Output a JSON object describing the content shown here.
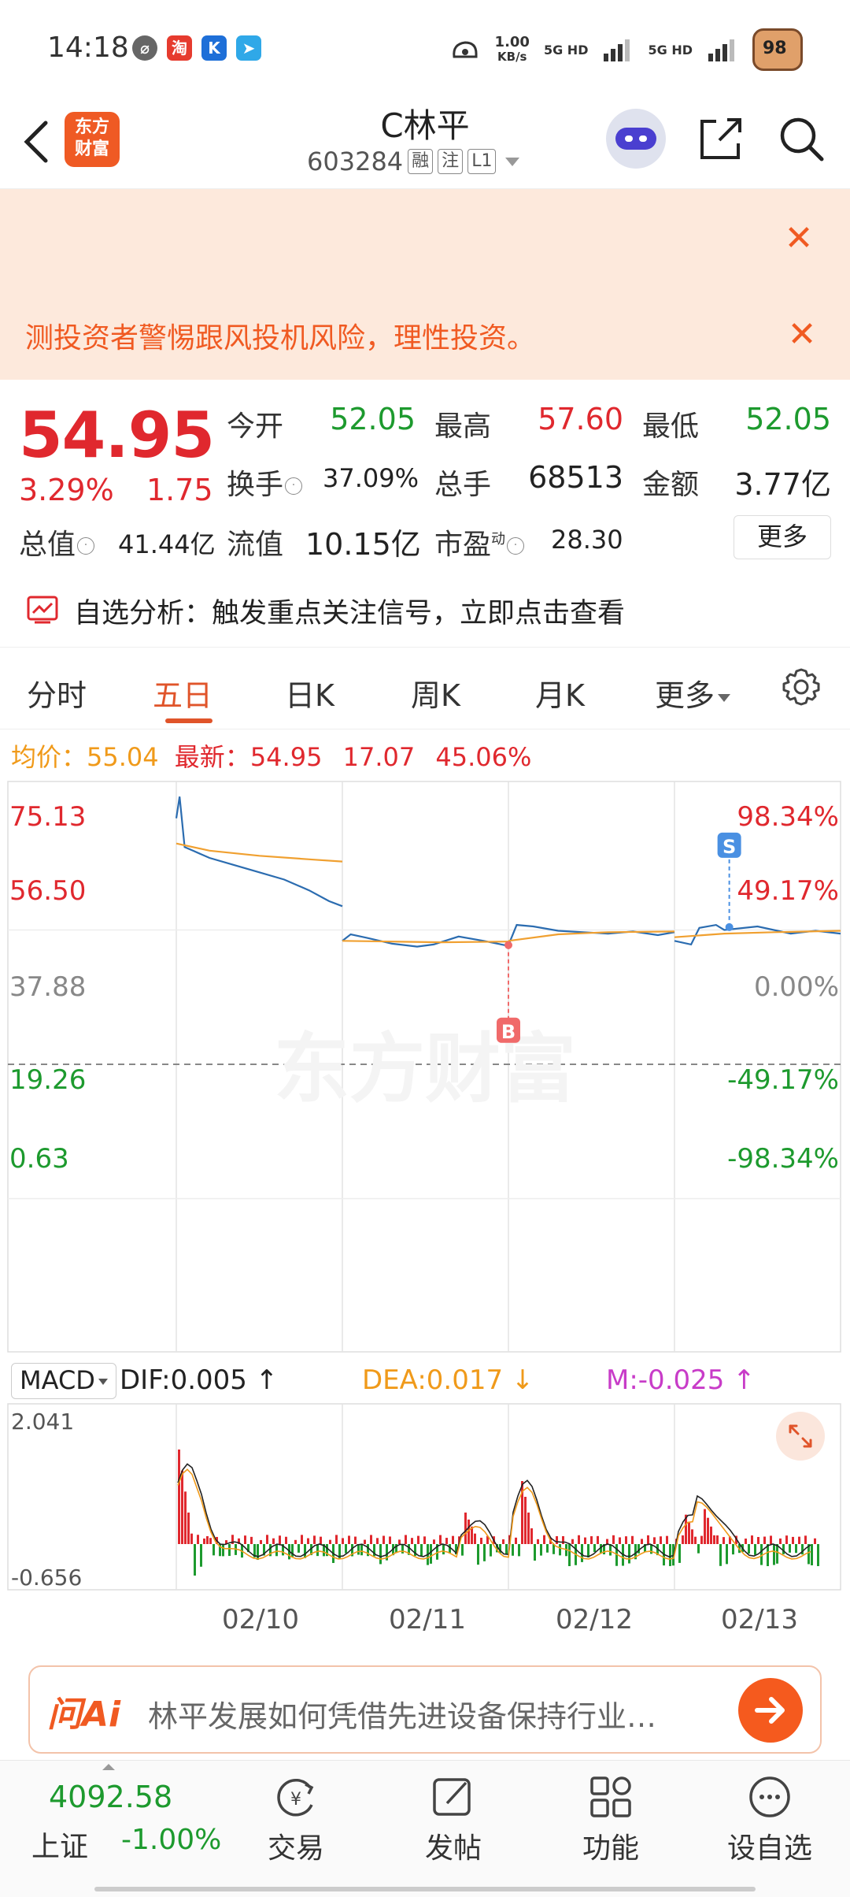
{
  "status_bar": {
    "time": "14:18",
    "net_speed_value": "1.00",
    "net_speed_unit": "KB/s",
    "sim1": "5G HD",
    "sim2": "5G HD",
    "battery": "98"
  },
  "header": {
    "logo_text_line1": "东方",
    "logo_text_line2": "财富",
    "title": "C林平",
    "code": "603284",
    "tags": [
      "融",
      "注",
      "L1"
    ]
  },
  "alerts": {
    "message": "测投资者警惕跟风投机风险，理性投资。"
  },
  "quote": {
    "price": "54.95",
    "change_pct": "3.29%",
    "change_abs": "1.75",
    "rows": [
      [
        {
          "label": "今开",
          "value": "52.05",
          "color": "green"
        },
        {
          "label": "最高",
          "value": "57.60",
          "color": "red"
        },
        {
          "label": "最低",
          "value": "52.05",
          "color": "green"
        }
      ],
      [
        {
          "label": "换手",
          "value": "37.09%",
          "color": "black"
        },
        {
          "label": "总手",
          "value": "68513",
          "color": "black"
        },
        {
          "label": "金额",
          "value": "3.77亿",
          "color": "black"
        }
      ],
      [
        {
          "label": "总值",
          "value": "41.44亿",
          "color": "black"
        },
        {
          "label": "流值",
          "value": "10.15亿",
          "color": "black"
        },
        {
          "label": "市盈",
          "value": "28.30",
          "color": "black"
        }
      ]
    ],
    "pe_superscript": "动",
    "more_label": "更多"
  },
  "signal": {
    "text": "自选分析：触发重点关注信号，立即点击查看"
  },
  "tabs": [
    "分时",
    "五日",
    "日K",
    "周K",
    "月K",
    "更多"
  ],
  "active_tab": "五日",
  "infoline": {
    "avg_label": "均价：",
    "avg_value": "55.04",
    "latest_label": "最新：",
    "latest_value": "54.95",
    "change_abs": "17.07",
    "change_pct": "45.06%"
  },
  "chart_data": {
    "type": "line",
    "title": "",
    "y_left_ticks": [
      "75.13",
      "56.50",
      "37.88",
      "19.26",
      "0.63"
    ],
    "y_right_ticks": [
      "98.34%",
      "49.17%",
      "0.00%",
      "-49.17%",
      "-98.34%"
    ],
    "ylim": [
      0.63,
      75.13
    ],
    "reference_price": 37.88,
    "x_day_labels": [
      "02/10",
      "02/11",
      "02/12",
      "02/13"
    ],
    "watermark": "东方财富",
    "series": [
      {
        "name": "",
        "color": "#2b6cb0",
        "day_points": [
          [
            [
              0,
              72.0
            ],
            [
              0.02,
              75.0
            ],
            [
              0.05,
              68
            ],
            [
              0.1,
              67.5
            ],
            [
              0.2,
              66.5
            ],
            [
              0.35,
              65.5
            ],
            [
              0.5,
              64.5
            ],
            [
              0.65,
              63.5
            ],
            [
              0.8,
              62
            ],
            [
              0.92,
              60.5
            ],
            [
              1,
              59.8
            ]
          ],
          [
            [
              0,
              55.0
            ],
            [
              0.05,
              55.9
            ],
            [
              0.15,
              55.4
            ],
            [
              0.3,
              54.6
            ],
            [
              0.45,
              54.2
            ],
            [
              0.55,
              54.5
            ],
            [
              0.7,
              55.6
            ],
            [
              0.85,
              55.0
            ],
            [
              1,
              54.3
            ]
          ],
          [
            [
              0,
              54.4
            ],
            [
              0.05,
              57.2
            ],
            [
              0.15,
              57.0
            ],
            [
              0.3,
              56.4
            ],
            [
              0.45,
              56.2
            ],
            [
              0.6,
              56.0
            ],
            [
              0.75,
              56.3
            ],
            [
              0.9,
              55.8
            ],
            [
              1,
              56.2
            ]
          ],
          [
            [
              0,
              55.0
            ],
            [
              0.1,
              54.5
            ],
            [
              0.15,
              56.8
            ],
            [
              0.25,
              57.2
            ],
            [
              0.3,
              56.5
            ],
            [
              0.5,
              57.0
            ],
            [
              0.7,
              56.0
            ],
            [
              0.85,
              56.4
            ],
            [
              1,
              56.0
            ]
          ]
        ]
      },
      {
        "name": "",
        "color": "#f0a030",
        "day_points": [
          [
            [
              0,
              68.5
            ],
            [
              0.2,
              67.5
            ],
            [
              0.5,
              66.8
            ],
            [
              0.8,
              66.3
            ],
            [
              1,
              66.0
            ]
          ],
          [
            [
              0,
              55.0
            ],
            [
              0.3,
              54.9
            ],
            [
              0.6,
              54.8
            ],
            [
              1,
              54.9
            ]
          ],
          [
            [
              0,
              55.0
            ],
            [
              0.3,
              55.9
            ],
            [
              0.6,
              56.2
            ],
            [
              1,
              56.3
            ]
          ],
          [
            [
              0,
              55.5
            ],
            [
              0.3,
              56.0
            ],
            [
              0.6,
              56.2
            ],
            [
              1,
              56.4
            ]
          ]
        ]
      }
    ],
    "markers": [
      {
        "label": "B",
        "day": 2,
        "pos": 0.0,
        "price": 54.4,
        "color": "#f06a6a"
      },
      {
        "label": "S",
        "day": 3,
        "pos": 0.33,
        "price": 56.9,
        "color": "#4a90e2"
      }
    ]
  },
  "macd": {
    "selector": "MACD",
    "dif": "DIF:0.005",
    "dea": "DEA:0.017",
    "m": "M:-0.025",
    "y_top": "2.041",
    "y_bottom": "-0.656"
  },
  "ai": {
    "logo": "问Ai",
    "prompt": "林平发展如何凭借先进设备保持行业…"
  },
  "bottom_nav": {
    "index_value": "4092.58",
    "index_name": "上证",
    "index_change": "-1.00%",
    "items": [
      "交易",
      "发帖",
      "功能",
      "设自选"
    ]
  }
}
